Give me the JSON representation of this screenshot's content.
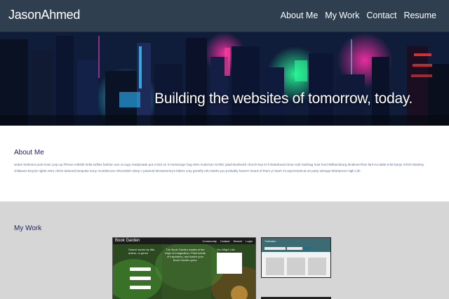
{
  "navbar": {
    "brand": "JasonAhmed",
    "links": [
      "About Me",
      "My Work",
      "Contact",
      "Resume"
    ]
  },
  "hero": {
    "title": "Building the websites of tomorrow, today."
  },
  "about": {
    "title": "About Me",
    "text": "seitan heirloom post-ironic pop-up iPhone mikshk hella selfies fashion axe occupy readymade put a bird on it messenger bag Wes Anderson Schlitz plaid Bushwick church-key lo-fi skateboard slow-carb hashtag trust fund Williamsburg biodiesel fixie farm-to-table 8-bit banjo XOXO Banksy chillwave bicycle rights retro cliche tattooed bespoke irony mumblecore Shoreditch deep v polaroid McSweeney's bitters cray gentrify tofu Marfa you probably haven't heard of them yr banh mi asymmetrical art party selvage letterpress High Life."
  },
  "work": {
    "title": "My Work",
    "book_garden": {
      "brand": "Book Garden",
      "links": [
        "Community",
        "Contact",
        "Search",
        "Login"
      ],
      "col1": "Search books by title, author, or genre",
      "col2": "The Book Garden awaits at the edge of imagination. Plant seeds of inspiration, and watch your Book Garden grow.",
      "col3": "You Might Like"
    },
    "trailmaker": {
      "title": "Trailmaker"
    }
  },
  "colors": {
    "navbar": "#2f3f4f",
    "section_title": "#1b1f6b",
    "about_text": "#5a6fa8",
    "work_bg": "#d6d6d6"
  }
}
